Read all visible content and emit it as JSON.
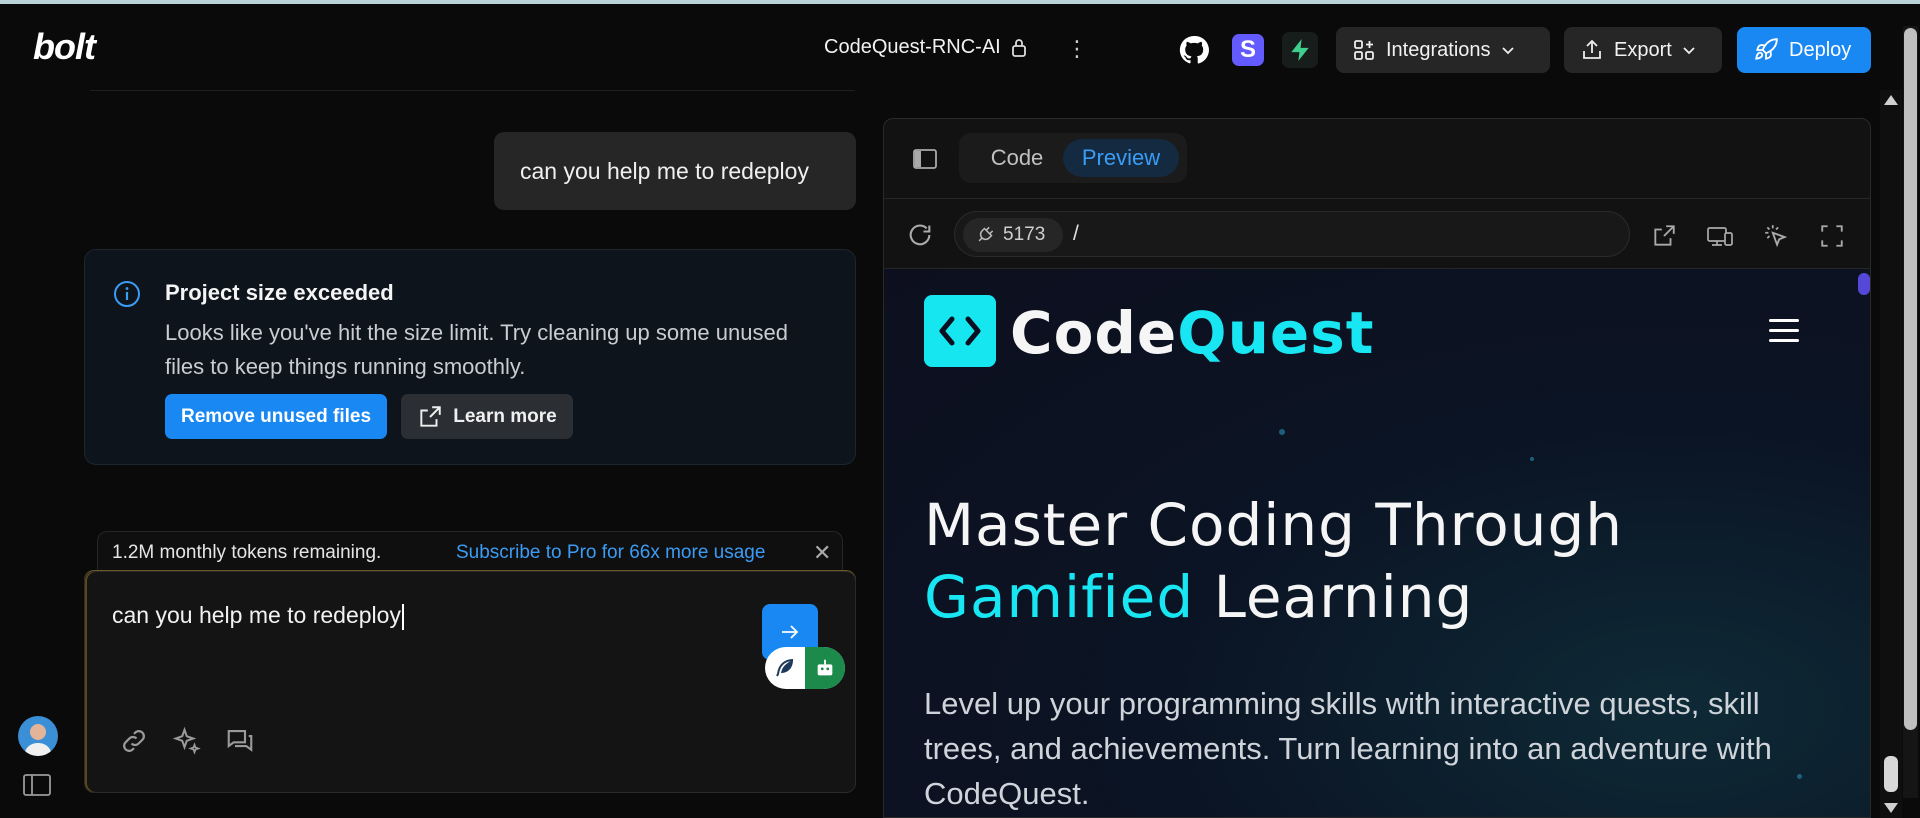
{
  "app": {
    "logo": "bolt",
    "project_name": "CodeQuest-RNC-AI",
    "kebab": "⋮",
    "stripe_letter": "S",
    "buttons": {
      "integrations": "Integrations",
      "export": "Export",
      "deploy": "Deploy"
    }
  },
  "chat": {
    "user_message": "can you help me to redeploy",
    "alert": {
      "title": "Project size exceeded",
      "message": "Looks like you've hit the size limit. Try cleaning up some unused files to keep things running smoothly.",
      "remove_button": "Remove unused files",
      "learn_button": "Learn more"
    },
    "tokens": {
      "remaining": "1.2M monthly tokens remaining.",
      "upsell": "Subscribe to Pro for 66x more usage",
      "close": "✕"
    },
    "composer": {
      "value": "can you help me to redeploy"
    }
  },
  "preview": {
    "tabs": {
      "code": "Code",
      "preview": "Preview",
      "active": "Preview"
    },
    "port": "5173",
    "path": "/",
    "site": {
      "brand_part1": "Code",
      "brand_part2": "Quest",
      "hero_line1": "Master Coding Through",
      "hero_accent": "Gamified",
      "hero_rest": " Learning",
      "subtitle": "Level up your programming skills with interactive quests, skill trees, and achievements. Turn learning into an adventure with CodeQuest."
    }
  },
  "colors": {
    "accent_blue": "#1a88f2",
    "cyan": "#18e6f2",
    "stripe": "#635bff",
    "supabase_green": "#3ecf8e"
  },
  "icons": [
    "lock-icon",
    "github-icon",
    "stripe-icon",
    "supabase-icon",
    "integrations-icon",
    "export-icon",
    "deploy-rocket-icon",
    "info-icon",
    "external-link-icon",
    "send-arrow-icon",
    "feather-icon",
    "robot-icon",
    "link-icon",
    "sparkles-icon",
    "chat-icon",
    "sidebar-toggle-icon",
    "reload-icon",
    "plug-icon",
    "open-new-tab-icon",
    "device-icon",
    "select-cursor-icon",
    "fullscreen-icon",
    "code-brackets-icon",
    "hamburger-icon"
  ]
}
